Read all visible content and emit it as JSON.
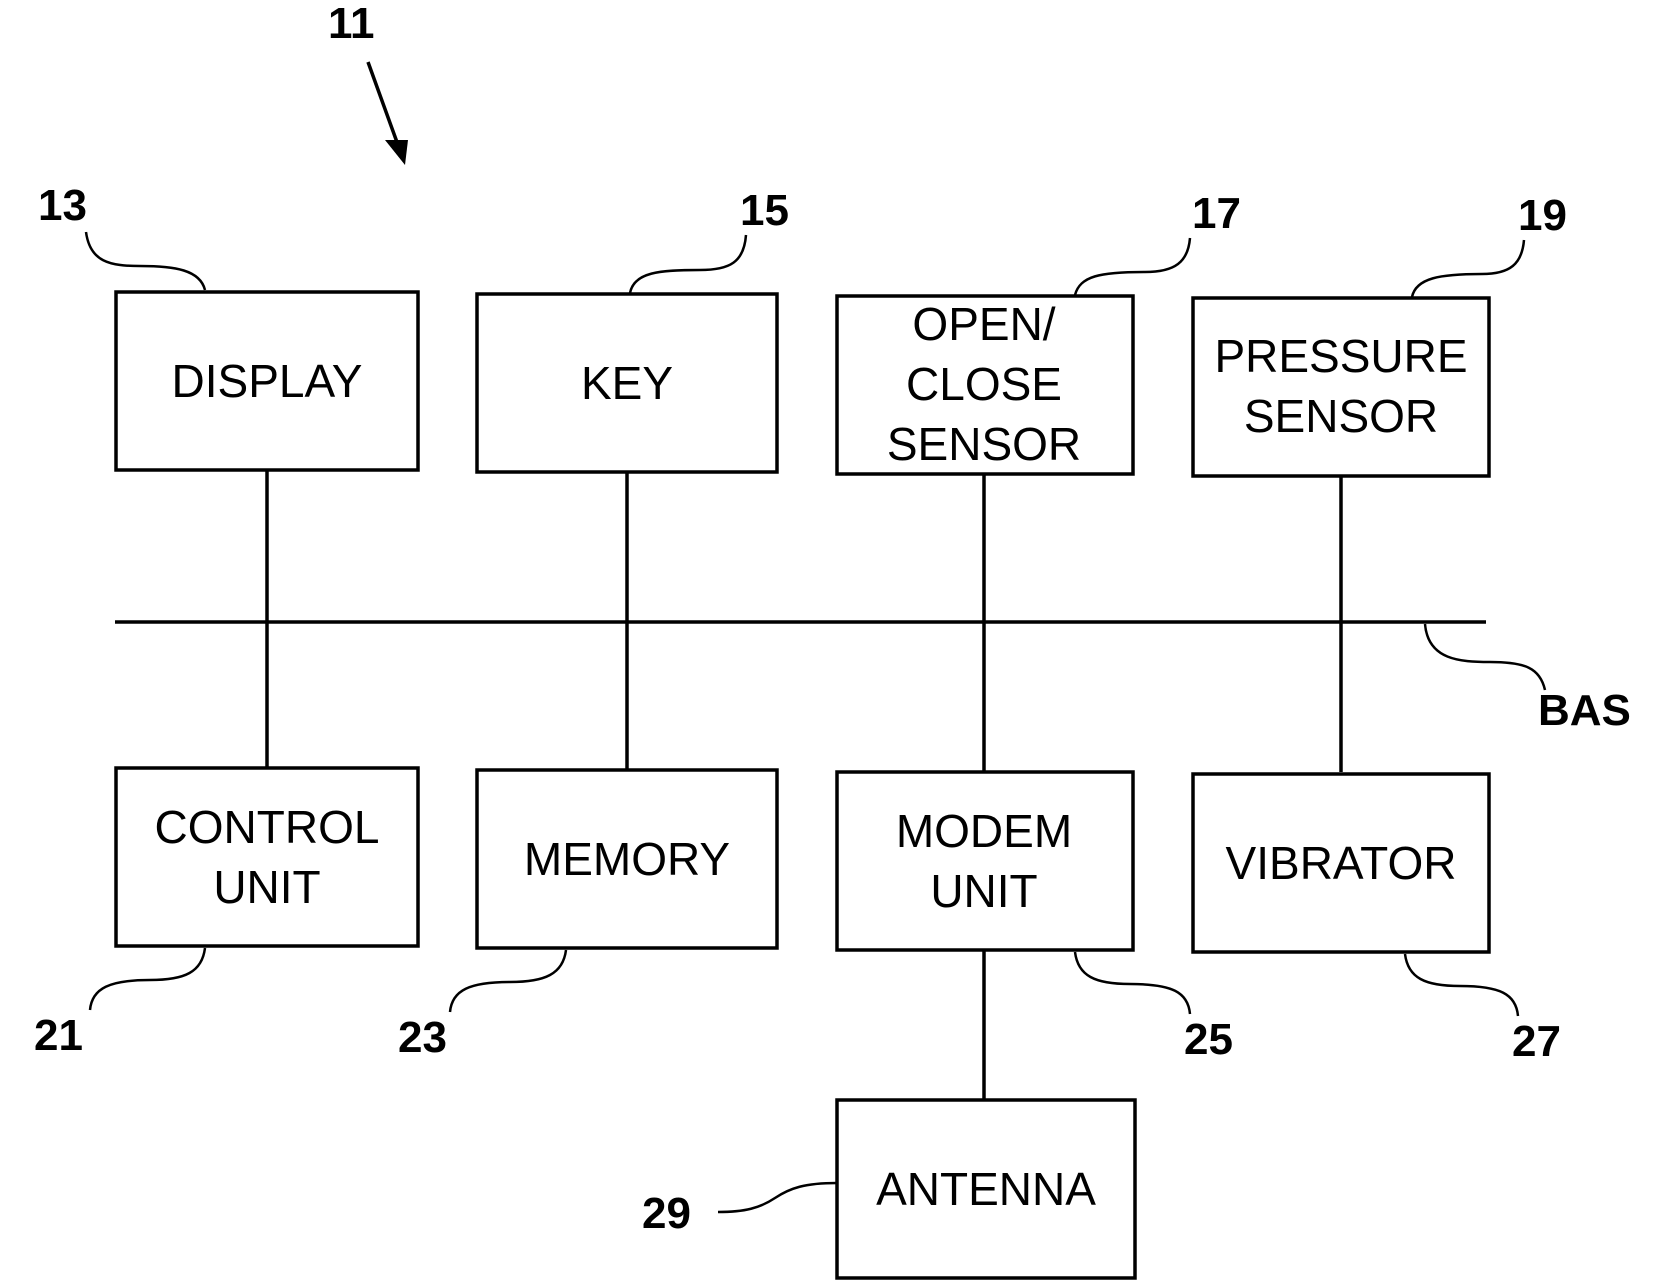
{
  "figure": {
    "ref": "11",
    "bus": {
      "ref": "BAS"
    },
    "blocks": [
      {
        "id": "display",
        "ref": "13",
        "lines": [
          "DISPLAY"
        ]
      },
      {
        "id": "key",
        "ref": "15",
        "lines": [
          "KEY"
        ]
      },
      {
        "id": "open-close-sensor",
        "ref": "17",
        "lines": [
          "OPEN/",
          "CLOSE",
          "SENSOR"
        ]
      },
      {
        "id": "pressure-sensor",
        "ref": "19",
        "lines": [
          "PRESSURE",
          "SENSOR"
        ]
      },
      {
        "id": "control-unit",
        "ref": "21",
        "lines": [
          "CONTROL",
          "UNIT"
        ]
      },
      {
        "id": "memory",
        "ref": "23",
        "lines": [
          "MEMORY"
        ]
      },
      {
        "id": "modem-unit",
        "ref": "25",
        "lines": [
          "MODEM",
          "UNIT"
        ]
      },
      {
        "id": "vibrator",
        "ref": "27",
        "lines": [
          "VIBRATOR"
        ]
      },
      {
        "id": "antenna",
        "ref": "29",
        "lines": [
          "ANTENNA"
        ]
      }
    ],
    "connections": [
      [
        "display",
        "bus"
      ],
      [
        "key",
        "bus"
      ],
      [
        "open-close-sensor",
        "bus"
      ],
      [
        "pressure-sensor",
        "bus"
      ],
      [
        "control-unit",
        "bus"
      ],
      [
        "memory",
        "bus"
      ],
      [
        "modem-unit",
        "bus"
      ],
      [
        "vibrator",
        "bus"
      ],
      [
        "modem-unit",
        "antenna"
      ]
    ]
  }
}
